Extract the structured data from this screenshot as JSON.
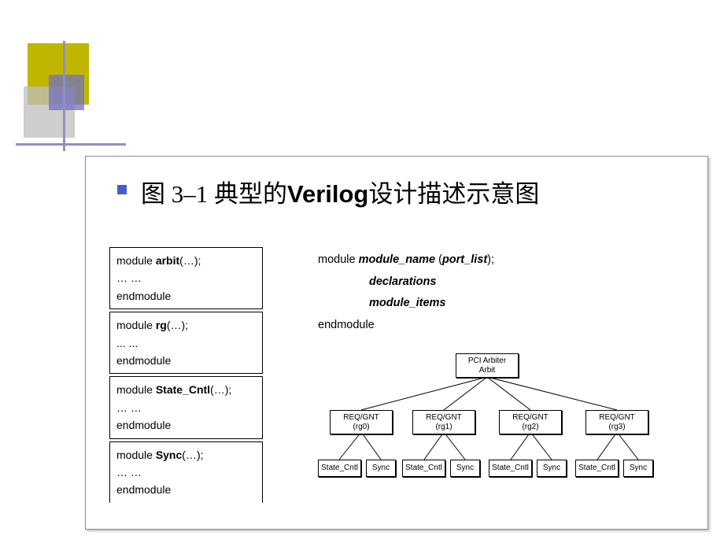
{
  "title": {
    "prefix": "图 3–1 典型的",
    "bold": "Verilog",
    "suffix": "设计描述示意图"
  },
  "module_boxes": [
    {
      "head": "module arbit(…);",
      "body": "… …",
      "end": "endmodule"
    },
    {
      "head": "module rg(…);",
      "body": "... ...",
      "end": "endmodule"
    },
    {
      "head": "module State_Cntl(…);",
      "body": "… …",
      "end": "endmodule"
    },
    {
      "head": "module Sync(…);",
      "body": "… …",
      "end": "endmodule"
    }
  ],
  "template": {
    "line1_pre": "module ",
    "line1_name": "module_name",
    "line1_mid": " (",
    "line1_port": "port_list",
    "line1_post": ");",
    "line2": "declarations",
    "line3": "module_items",
    "line4": "endmodule"
  },
  "tree": {
    "root": {
      "l1": "PCI Arbiter",
      "l2": "Arbit"
    },
    "reqs": [
      {
        "l1": "REQ/GNT",
        "l2": "(rg0)"
      },
      {
        "l1": "REQ/GNT",
        "l2": "(rg1)"
      },
      {
        "l1": "REQ/GNT",
        "l2": "(rg2)"
      },
      {
        "l1": "REQ/GNT",
        "l2": "(rg3)"
      }
    ],
    "leaf_state": "State_Cntl",
    "leaf_sync": "Sync"
  }
}
